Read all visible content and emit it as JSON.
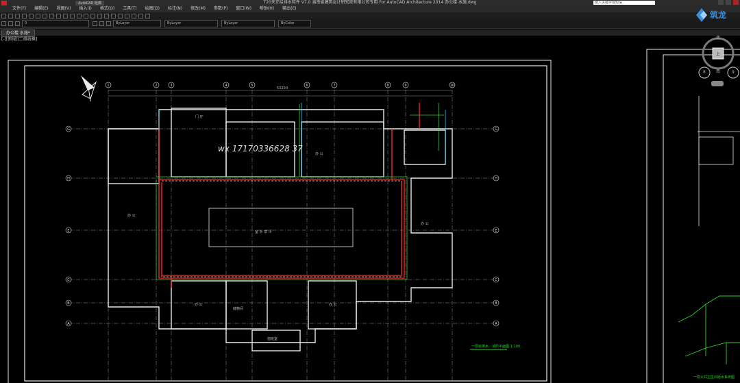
{
  "window": {
    "title": "T20天正给排水软件 V7.0  湖南省建筑设计研究院有限公司专用  For AutoCAD Architecture 2014    办公楼 水施.dwg",
    "workspace": "AutoCAD 经典",
    "search_placeholder": "键入关键字或短语"
  },
  "menu": [
    "文件(F)",
    "编辑(E)",
    "视图(V)",
    "插入(I)",
    "格式(O)",
    "工具(T)",
    "绘图(D)",
    "标注(N)",
    "修改(M)",
    "参数(P)",
    "窗口(W)",
    "帮助(H)",
    "输出(E)"
  ],
  "toolbar": {
    "layer_value": "0",
    "color_value": "ByLayer",
    "linetype_value": "ByLayer",
    "lineweight_value": "ByLayer",
    "plotstyle_value": "ByColor"
  },
  "tabs": [
    {
      "label": "办公楼 水施*"
    }
  ],
  "viewport_label": "[-][俯视][二维线框]",
  "watermark": "wx 17170336628 37",
  "viewcube": {
    "north": "北",
    "south": "南",
    "center": "上",
    "left_num": "8",
    "right_num": "9"
  },
  "drawing": {
    "grid_columns": [
      "1",
      "2",
      "3",
      "4",
      "5",
      "6",
      "7",
      "8",
      "9",
      "10"
    ],
    "grid_rows": [
      "G",
      "H",
      "E",
      "C",
      "B",
      "A"
    ],
    "total_dim": "53200",
    "room_labels": [
      "办 公",
      "办 公",
      "门 厅",
      "办 公",
      "室 外 草 坪",
      "办 公",
      "储物间",
      "办 公",
      "值班室"
    ],
    "caption": "一层给排水、消防平面图 1:100",
    "caption_right": "一层公共卫生间给水系统图"
  },
  "logo_text": "筑龙",
  "colors": {
    "accent_red": "#ff2a2a",
    "accent_green": "#29d629",
    "accent_cyan": "#2ad4ff",
    "line_white": "#e8e8e8",
    "dim_grey": "#9a9a9a"
  }
}
